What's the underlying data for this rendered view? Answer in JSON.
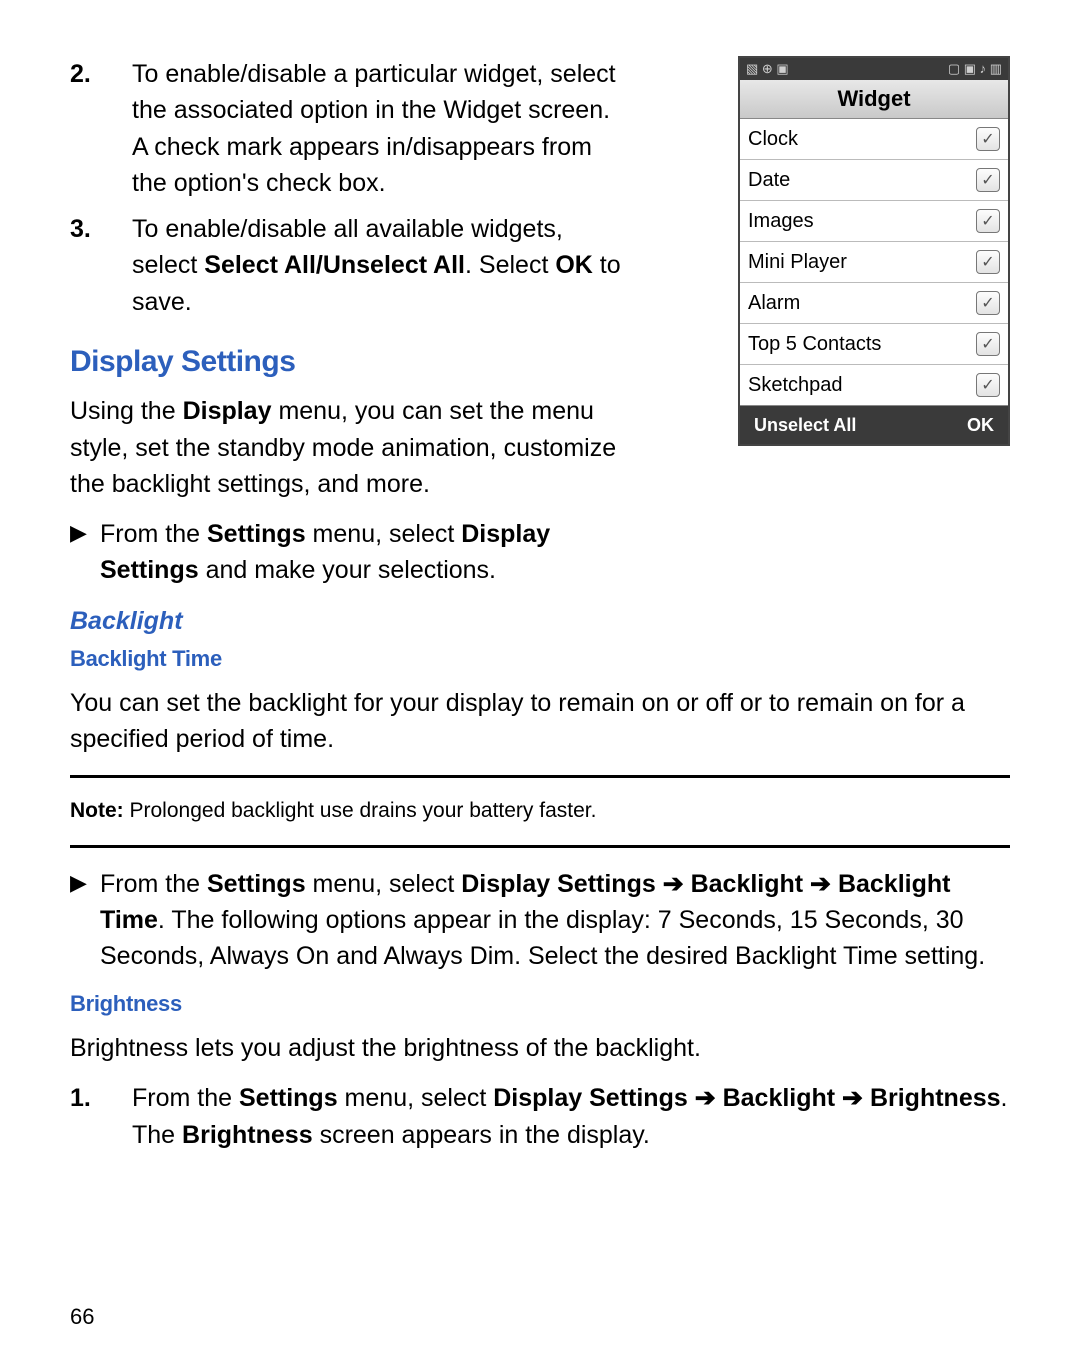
{
  "steps": {
    "s2_num": "2.",
    "s2_text_a": "To enable/disable a particular widget, select the associated option in the Widget screen. A check mark appears in/disappears from the option's check box.",
    "s3_num": "3.",
    "s3_text_a": "To enable/disable all available widgets, select ",
    "s3_bold1": "Select All/Unselect All",
    "s3_text_b": ". Select ",
    "s3_bold2": "OK",
    "s3_text_c": " to save."
  },
  "h_display": "Display Settings",
  "p_display_a": "Using the ",
  "p_display_b": "Display",
  "p_display_c": " menu, you can set the menu style, set the standby mode animation, customize the backlight settings, and more.",
  "b1_a": "From the ",
  "b1_b": "Settings",
  "b1_c": " menu, select ",
  "b1_d": "Display Settings",
  "b1_e": " and make your selections.",
  "h_backlight": "Backlight",
  "h_backlight_time": "Backlight Time",
  "p_bt": "You can set the backlight for your display to remain on or off or to remain on for a specified period of time.",
  "note_a": "Note:",
  "note_b": " Prolonged backlight use drains your battery faster.",
  "b2_a": "From the ",
  "b2_b": "Settings",
  "b2_c": " menu, select ",
  "b2_d": "Display Settings ➔ Backlight ➔ Backlight Time",
  "b2_e": ". The following options appear in the display: 7 Seconds, 15 Seconds, 30 Seconds, Always On and Always Dim. Select the desired Backlight Time setting.",
  "h_brightness": "Brightness",
  "p_bright": "Brightness lets you adjust the brightness of the backlight.",
  "s1b_num": "1.",
  "s1b_a": "From the ",
  "s1b_b": "Settings",
  "s1b_c": " menu, select ",
  "s1b_d": "Display Settings ➔ Backlight ➔ Brightness",
  "s1b_e": ". The ",
  "s1b_f": "Brightness",
  "s1b_g": " screen appears in the display.",
  "pagenum": "66",
  "phone": {
    "title": "Widget",
    "rows": [
      "Clock",
      "Date",
      "Images",
      "Mini Player",
      "Alarm",
      "Top 5 Contacts",
      "Sketchpad"
    ],
    "soft_left": "Unselect All",
    "soft_right": "OK",
    "status_left": "▧   ⊕ ▣",
    "status_right": "▢ ▣ ♪ ▥"
  }
}
